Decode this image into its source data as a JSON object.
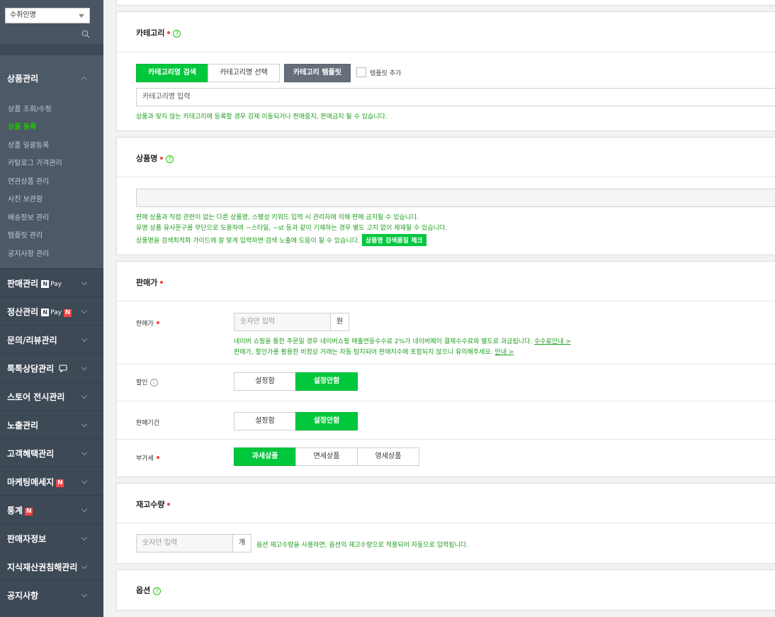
{
  "sidebar": {
    "store_select": "수취인명",
    "search_icon": "search-icon",
    "product_group": {
      "title": "상품관리",
      "items": [
        "상품 조회/수정",
        "상품 등록",
        "상품 일괄등록",
        "카탈로그 가격관리",
        "연관상품 관리",
        "사진 보관함",
        "배송정보 관리",
        "템플릿 관리",
        "공지사항 관리"
      ],
      "active_index": 1
    },
    "menu": [
      {
        "label": "판매관리",
        "npay": true,
        "new": false
      },
      {
        "label": "정산관리",
        "npay": true,
        "new": true
      },
      {
        "label": "문의/리뷰관리",
        "npay": false,
        "new": false
      },
      {
        "label": "톡톡상담관리",
        "npay": false,
        "new": false,
        "chat_icon": true
      },
      {
        "label": "스토어 전시관리",
        "npay": false,
        "new": false
      },
      {
        "label": "노출관리",
        "npay": false,
        "new": false
      },
      {
        "label": "고객혜택관리",
        "npay": false,
        "new": false
      },
      {
        "label": "마케팅메세지",
        "npay": false,
        "new": true
      },
      {
        "label": "통계",
        "npay": false,
        "new": true
      },
      {
        "label": "판매자정보",
        "npay": false,
        "new": false
      },
      {
        "label": "지식재산권침해관리",
        "npay": false,
        "new": false
      },
      {
        "label": "공지사항",
        "npay": false,
        "new": false
      }
    ],
    "npay_n": "N",
    "npay_pay": "Pay",
    "new_badge": "N"
  },
  "category": {
    "title": "카테고리",
    "help": "?",
    "tab_search": "카테고리명 검색",
    "tab_select": "카테고리명 선택",
    "template_button": "카테고리 템플릿",
    "template_add": "템플릿 추가",
    "input_placeholder": "카테고리명 입력",
    "notice": "상품과 맞지 않는 카테고리에 등록할 경우 강제 이동되거나 판매중지, 판매금지 될 수 있습니다."
  },
  "product_name": {
    "title": "상품명",
    "help": "?",
    "input_value": "",
    "notice_1": "판매 상품과 직접 관련이 없는 다른 상품명, 스팸성 키워드 입력 시 관리자에 의해 판매 금지될 수 있습니다.",
    "notice_2": "유명 상품 유사문구를 무단으로 도용하여 ~스타일, ~st 등과 같이 기재하는 경우 별도 고지 없이 제재될 수 있습니다.",
    "notice_3": "상품명을 검색최적화 가이드에 잘 맞게 입력하면 검색 노출에 도움이 될 수 있습니다.",
    "check_button": "상품명 검색품질 체크"
  },
  "price": {
    "title": "판매가",
    "price_label": "판매가",
    "price_placeholder": "숫자만 입력",
    "price_unit": "원",
    "notice_1": "네이버 쇼핑을 통한 주문일 경우 네이버쇼핑 매출연동수수료 2%가 네이버페이 결제수수료와 별도로 과금됩니다.",
    "notice_1_link": "수수료안내 >",
    "notice_2": "판매가, 할인가를 활용한 비정상 거래는 자동 탐지되어 판매지수에 포함되지 않으니 유의해주세요.",
    "notice_2_link": "안내 >",
    "discount_label": "할인",
    "info": "i",
    "discount_on": "설정함",
    "discount_off": "설정안함",
    "period_label": "판매기간",
    "period_on": "설정함",
    "period_off": "설정안함",
    "vat_label": "부가세",
    "vat_taxable": "과세상품",
    "vat_free": "면세상품",
    "vat_zero": "영세상품"
  },
  "stock": {
    "title": "재고수량",
    "placeholder": "숫자만 입력",
    "unit": "개",
    "notice": "옵션 재고수량을 사용하면, 옵션의 재고수량으로 적용되어 자동으로 입력됩니다."
  },
  "option": {
    "title": "옵션",
    "help": "?"
  }
}
